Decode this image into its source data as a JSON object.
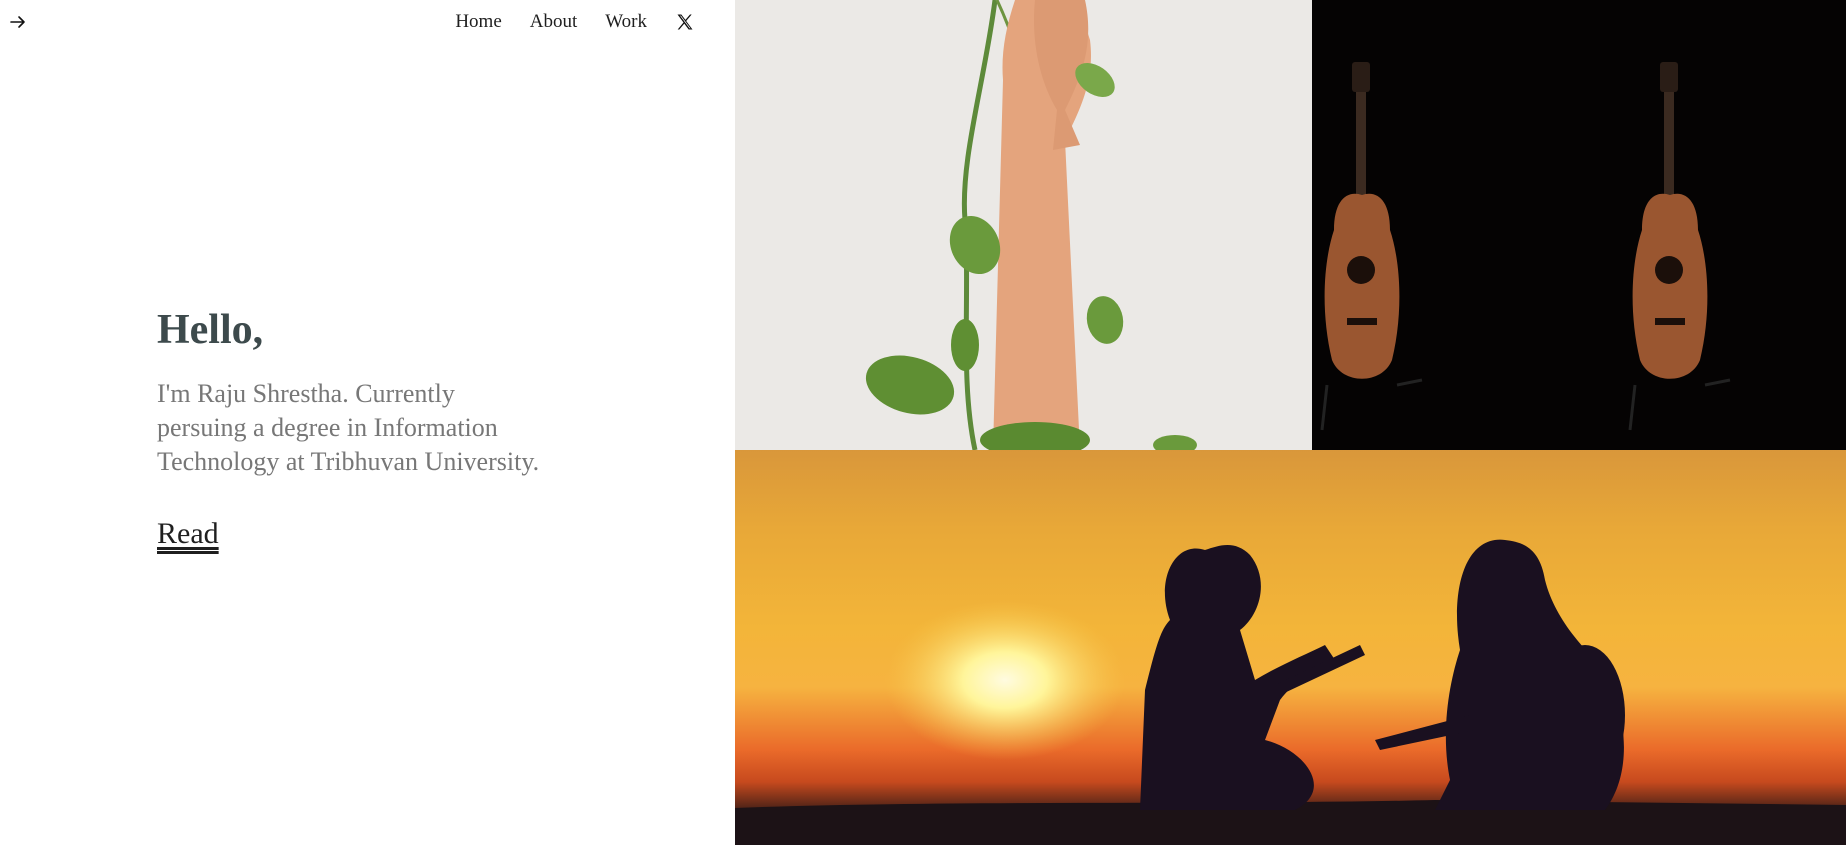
{
  "nav": {
    "back_icon": "arrow-right-icon",
    "links": [
      "Home",
      "About",
      "Work"
    ],
    "social_icon": "x-logo-icon"
  },
  "hero": {
    "greeting": "Hello,",
    "intro": "I'm Raju Shrestha. Currently persuing a degree in Information Technology at Tribhuvan University.",
    "read_label": "Read"
  },
  "gallery": {
    "images": [
      "hand-with-vine-photo",
      "two-guitars-photo",
      "sunset-guitar-players-photo"
    ]
  },
  "colors": {
    "heading": "#3d4a4c",
    "body_text": "#777777",
    "link": "#1f1f1f"
  }
}
